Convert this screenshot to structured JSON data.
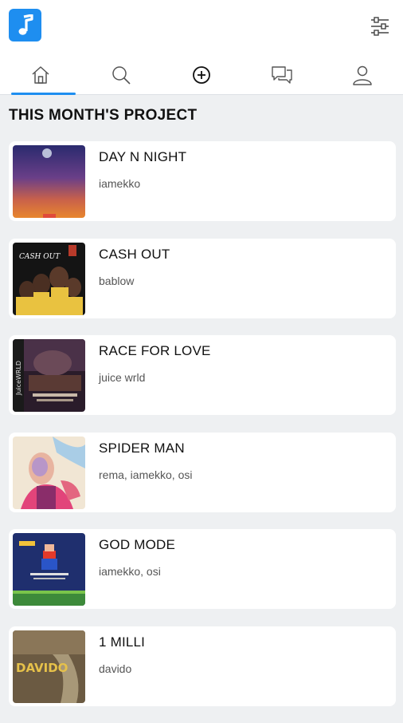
{
  "header": {
    "logo_icon": "music-note-icon",
    "filter_icon": "sliders-icon",
    "accent_color": "#1e8ef0"
  },
  "tabs": [
    {
      "icon": "home-icon",
      "active": true
    },
    {
      "icon": "search-icon",
      "active": false
    },
    {
      "icon": "add-circle-icon",
      "active": false
    },
    {
      "icon": "messages-icon",
      "active": false
    },
    {
      "icon": "profile-icon",
      "active": false
    }
  ],
  "section": {
    "title": "THIS MONTH'S PROJECT"
  },
  "projects": [
    {
      "title": "DAY N NIGHT",
      "artist": "iamekko"
    },
    {
      "title": "CASH OUT",
      "artist": "bablow"
    },
    {
      "title": "RACE FOR LOVE",
      "artist": "juice wrld"
    },
    {
      "title": "SPIDER MAN",
      "artist": "rema, iamekko, osi"
    },
    {
      "title": "GOD MODE",
      "artist": "iamekko, osi"
    },
    {
      "title": "1 MILLI",
      "artist": "davido"
    }
  ],
  "cover_text": {
    "cash_out": "CASH OUT",
    "race_for_love": "JuiceWRLD",
    "one_milli": "DAVIDO"
  }
}
